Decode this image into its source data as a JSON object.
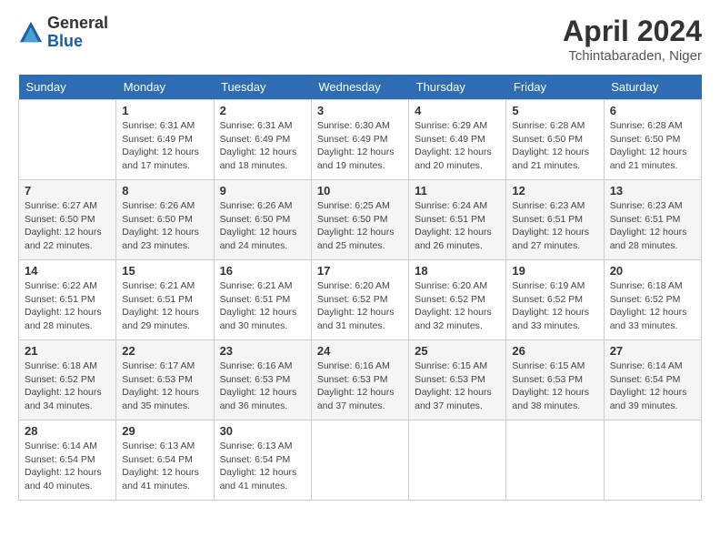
{
  "logo": {
    "general": "General",
    "blue": "Blue"
  },
  "title": "April 2024",
  "subtitle": "Tchintabaraden, Niger",
  "days_of_week": [
    "Sunday",
    "Monday",
    "Tuesday",
    "Wednesday",
    "Thursday",
    "Friday",
    "Saturday"
  ],
  "weeks": [
    [
      {
        "day": "",
        "info": ""
      },
      {
        "day": "1",
        "info": "Sunrise: 6:31 AM\nSunset: 6:49 PM\nDaylight: 12 hours and 17 minutes."
      },
      {
        "day": "2",
        "info": "Sunrise: 6:31 AM\nSunset: 6:49 PM\nDaylight: 12 hours and 18 minutes."
      },
      {
        "day": "3",
        "info": "Sunrise: 6:30 AM\nSunset: 6:49 PM\nDaylight: 12 hours and 19 minutes."
      },
      {
        "day": "4",
        "info": "Sunrise: 6:29 AM\nSunset: 6:49 PM\nDaylight: 12 hours and 20 minutes."
      },
      {
        "day": "5",
        "info": "Sunrise: 6:28 AM\nSunset: 6:50 PM\nDaylight: 12 hours and 21 minutes."
      },
      {
        "day": "6",
        "info": "Sunrise: 6:28 AM\nSunset: 6:50 PM\nDaylight: 12 hours and 21 minutes."
      }
    ],
    [
      {
        "day": "7",
        "info": "Sunrise: 6:27 AM\nSunset: 6:50 PM\nDaylight: 12 hours and 22 minutes."
      },
      {
        "day": "8",
        "info": "Sunrise: 6:26 AM\nSunset: 6:50 PM\nDaylight: 12 hours and 23 minutes."
      },
      {
        "day": "9",
        "info": "Sunrise: 6:26 AM\nSunset: 6:50 PM\nDaylight: 12 hours and 24 minutes."
      },
      {
        "day": "10",
        "info": "Sunrise: 6:25 AM\nSunset: 6:50 PM\nDaylight: 12 hours and 25 minutes."
      },
      {
        "day": "11",
        "info": "Sunrise: 6:24 AM\nSunset: 6:51 PM\nDaylight: 12 hours and 26 minutes."
      },
      {
        "day": "12",
        "info": "Sunrise: 6:23 AM\nSunset: 6:51 PM\nDaylight: 12 hours and 27 minutes."
      },
      {
        "day": "13",
        "info": "Sunrise: 6:23 AM\nSunset: 6:51 PM\nDaylight: 12 hours and 28 minutes."
      }
    ],
    [
      {
        "day": "14",
        "info": "Sunrise: 6:22 AM\nSunset: 6:51 PM\nDaylight: 12 hours and 28 minutes."
      },
      {
        "day": "15",
        "info": "Sunrise: 6:21 AM\nSunset: 6:51 PM\nDaylight: 12 hours and 29 minutes."
      },
      {
        "day": "16",
        "info": "Sunrise: 6:21 AM\nSunset: 6:51 PM\nDaylight: 12 hours and 30 minutes."
      },
      {
        "day": "17",
        "info": "Sunrise: 6:20 AM\nSunset: 6:52 PM\nDaylight: 12 hours and 31 minutes."
      },
      {
        "day": "18",
        "info": "Sunrise: 6:20 AM\nSunset: 6:52 PM\nDaylight: 12 hours and 32 minutes."
      },
      {
        "day": "19",
        "info": "Sunrise: 6:19 AM\nSunset: 6:52 PM\nDaylight: 12 hours and 33 minutes."
      },
      {
        "day": "20",
        "info": "Sunrise: 6:18 AM\nSunset: 6:52 PM\nDaylight: 12 hours and 33 minutes."
      }
    ],
    [
      {
        "day": "21",
        "info": "Sunrise: 6:18 AM\nSunset: 6:52 PM\nDaylight: 12 hours and 34 minutes."
      },
      {
        "day": "22",
        "info": "Sunrise: 6:17 AM\nSunset: 6:53 PM\nDaylight: 12 hours and 35 minutes."
      },
      {
        "day": "23",
        "info": "Sunrise: 6:16 AM\nSunset: 6:53 PM\nDaylight: 12 hours and 36 minutes."
      },
      {
        "day": "24",
        "info": "Sunrise: 6:16 AM\nSunset: 6:53 PM\nDaylight: 12 hours and 37 minutes."
      },
      {
        "day": "25",
        "info": "Sunrise: 6:15 AM\nSunset: 6:53 PM\nDaylight: 12 hours and 37 minutes."
      },
      {
        "day": "26",
        "info": "Sunrise: 6:15 AM\nSunset: 6:53 PM\nDaylight: 12 hours and 38 minutes."
      },
      {
        "day": "27",
        "info": "Sunrise: 6:14 AM\nSunset: 6:54 PM\nDaylight: 12 hours and 39 minutes."
      }
    ],
    [
      {
        "day": "28",
        "info": "Sunrise: 6:14 AM\nSunset: 6:54 PM\nDaylight: 12 hours and 40 minutes."
      },
      {
        "day": "29",
        "info": "Sunrise: 6:13 AM\nSunset: 6:54 PM\nDaylight: 12 hours and 41 minutes."
      },
      {
        "day": "30",
        "info": "Sunrise: 6:13 AM\nSunset: 6:54 PM\nDaylight: 12 hours and 41 minutes."
      },
      {
        "day": "",
        "info": ""
      },
      {
        "day": "",
        "info": ""
      },
      {
        "day": "",
        "info": ""
      },
      {
        "day": "",
        "info": ""
      }
    ]
  ]
}
